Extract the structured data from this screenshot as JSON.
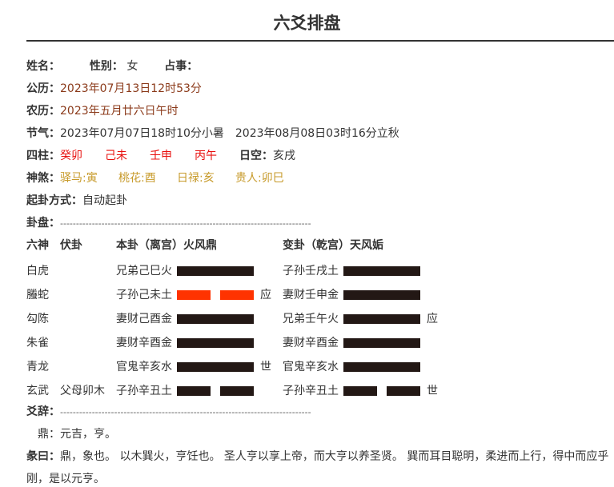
{
  "title": "六爻排盘",
  "info": {
    "name_label": "姓名：",
    "gender_label": "性别：",
    "gender_value": "女",
    "matter_label": "占事：",
    "solar_label": "公历：",
    "solar_value": "2023年07月13日12时53分",
    "lunar_label": "农历：",
    "lunar_value": "2023年五月廿六日午时",
    "solar_term_label": "节气：",
    "solar_term_value": "2023年07月07日18时10分小暑　2023年08月08日03时16分立秋",
    "pillars_label": "四柱：",
    "pillars": [
      "癸卯",
      "己未",
      "壬申",
      "丙午"
    ],
    "void_label": "日空：",
    "void_value": "亥戌",
    "shensha_label": "神煞：",
    "shensha": [
      "驿马:寅",
      "桃花:酉",
      "日禄:亥",
      "贵人:卯巳"
    ],
    "method_label": "起卦方式：",
    "method_value": "自动起卦",
    "chart_label": "卦盘：",
    "chart_dashes": "-------------------------------------------------------------------------------"
  },
  "table": {
    "headers": {
      "six_gods": "六神",
      "hidden": "伏卦",
      "original": "本卦（离宫）火风鼎",
      "changed": "变卦（乾宫）天风姤"
    },
    "rows": [
      {
        "god": "白虎",
        "hidden": "",
        "orig": "兄弟己巳火",
        "orig_line": "yang",
        "orig_moving": false,
        "orig_mark": "",
        "chg": "子孙壬戌土",
        "chg_line": "yang",
        "chg_mark": ""
      },
      {
        "god": "螣蛇",
        "hidden": "",
        "orig": "子孙己未土",
        "orig_line": "yin",
        "orig_moving": true,
        "orig_mark": "应",
        "chg": "妻财壬申金",
        "chg_line": "yang",
        "chg_mark": ""
      },
      {
        "god": "勾陈",
        "hidden": "",
        "orig": "妻财己酉金",
        "orig_line": "yang",
        "orig_moving": false,
        "orig_mark": "",
        "chg": "兄弟壬午火",
        "chg_line": "yang",
        "chg_mark": "应"
      },
      {
        "god": "朱雀",
        "hidden": "",
        "orig": "妻财辛酉金",
        "orig_line": "yang",
        "orig_moving": false,
        "orig_mark": "",
        "chg": "妻财辛酉金",
        "chg_line": "yang",
        "chg_mark": ""
      },
      {
        "god": "青龙",
        "hidden": "",
        "orig": "官鬼辛亥水",
        "orig_line": "yang",
        "orig_moving": false,
        "orig_mark": "世",
        "chg": "官鬼辛亥水",
        "chg_line": "yang",
        "chg_mark": ""
      },
      {
        "god": "玄武",
        "hidden": "父母卯木",
        "orig": "子孙辛丑土",
        "orig_line": "yin",
        "orig_moving": false,
        "orig_mark": "",
        "chg": "子孙辛丑土",
        "chg_line": "yin",
        "chg_mark": "世"
      }
    ]
  },
  "yao": {
    "label": "爻辞：",
    "dashes": "-------------------------------------------------------------------------------"
  },
  "texts": {
    "ding": "鼎：元吉，亨。",
    "tuan_label": "彖曰：",
    "tuan_line1": "鼎，象也。 以木巽火，亨饪也。 圣人亨以享上帝，而大亨以养圣贤。 巽而耳目聪明，柔进而上行，得中而应乎",
    "tuan_line2": "刚，是以元亨。"
  },
  "colors": {
    "solid_line": "#231815",
    "moving_line": "#ff3300",
    "brown": "#8b3a1a",
    "red": "#e8110f",
    "gold": "#c79a2a"
  }
}
